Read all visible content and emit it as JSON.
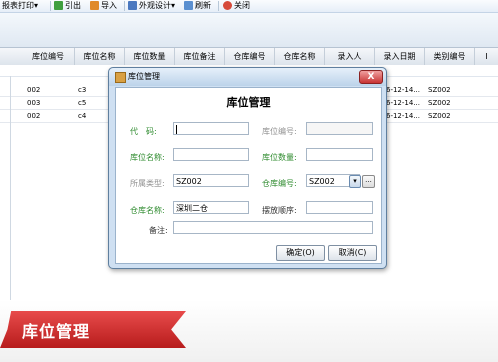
{
  "toolbar": {
    "items": [
      {
        "label": "报表打印",
        "icon": "dropdown-caret"
      },
      {
        "label": "引出",
        "icon": "export-icon"
      },
      {
        "label": "导入",
        "icon": "import-icon"
      },
      {
        "label": "外观设计",
        "icon": "design-icon"
      },
      {
        "label": "刷新",
        "icon": "refresh-icon"
      },
      {
        "label": "关闭",
        "icon": "close-icon"
      }
    ]
  },
  "grid": {
    "columns": [
      "库位编号",
      "库位名称",
      "库位数量",
      "库位备注",
      "仓库编号",
      "仓库名称",
      "录入人",
      "录入日期",
      "类别编号",
      "I"
    ],
    "rows": [
      {
        "code": "002",
        "name": "c3",
        "date": "6-12-14...",
        "category": "SZ002"
      },
      {
        "code": "003",
        "name": "c5",
        "date": "6-12-14...",
        "category": "SZ002"
      },
      {
        "code": "002",
        "name": "c4",
        "date": "6-12-14...",
        "category": "SZ002"
      }
    ]
  },
  "dialog": {
    "title": "库位管理",
    "form_title": "库位管理",
    "labels": {
      "code": "代　码:",
      "location_no": "库位编号:",
      "location_name": "库位名称:",
      "location_qty": "库位数量:",
      "category": "所属类型:",
      "warehouse_no": "仓库编号:",
      "warehouse_name": "仓库名称:",
      "sort_order": "摆放顺序:",
      "remark": "备注:"
    },
    "values": {
      "category": "SZ002",
      "warehouse_no": "SZ002",
      "warehouse_name": "深圳二仓"
    },
    "buttons": {
      "ok": "确定(O)",
      "cancel": "取消(C)",
      "close": "X",
      "more": "..."
    }
  },
  "banner": {
    "label": "库位管理"
  },
  "colors": {
    "banner_red": "#c62828",
    "label_green": "#2e8b2e",
    "label_gray": "#909090"
  }
}
